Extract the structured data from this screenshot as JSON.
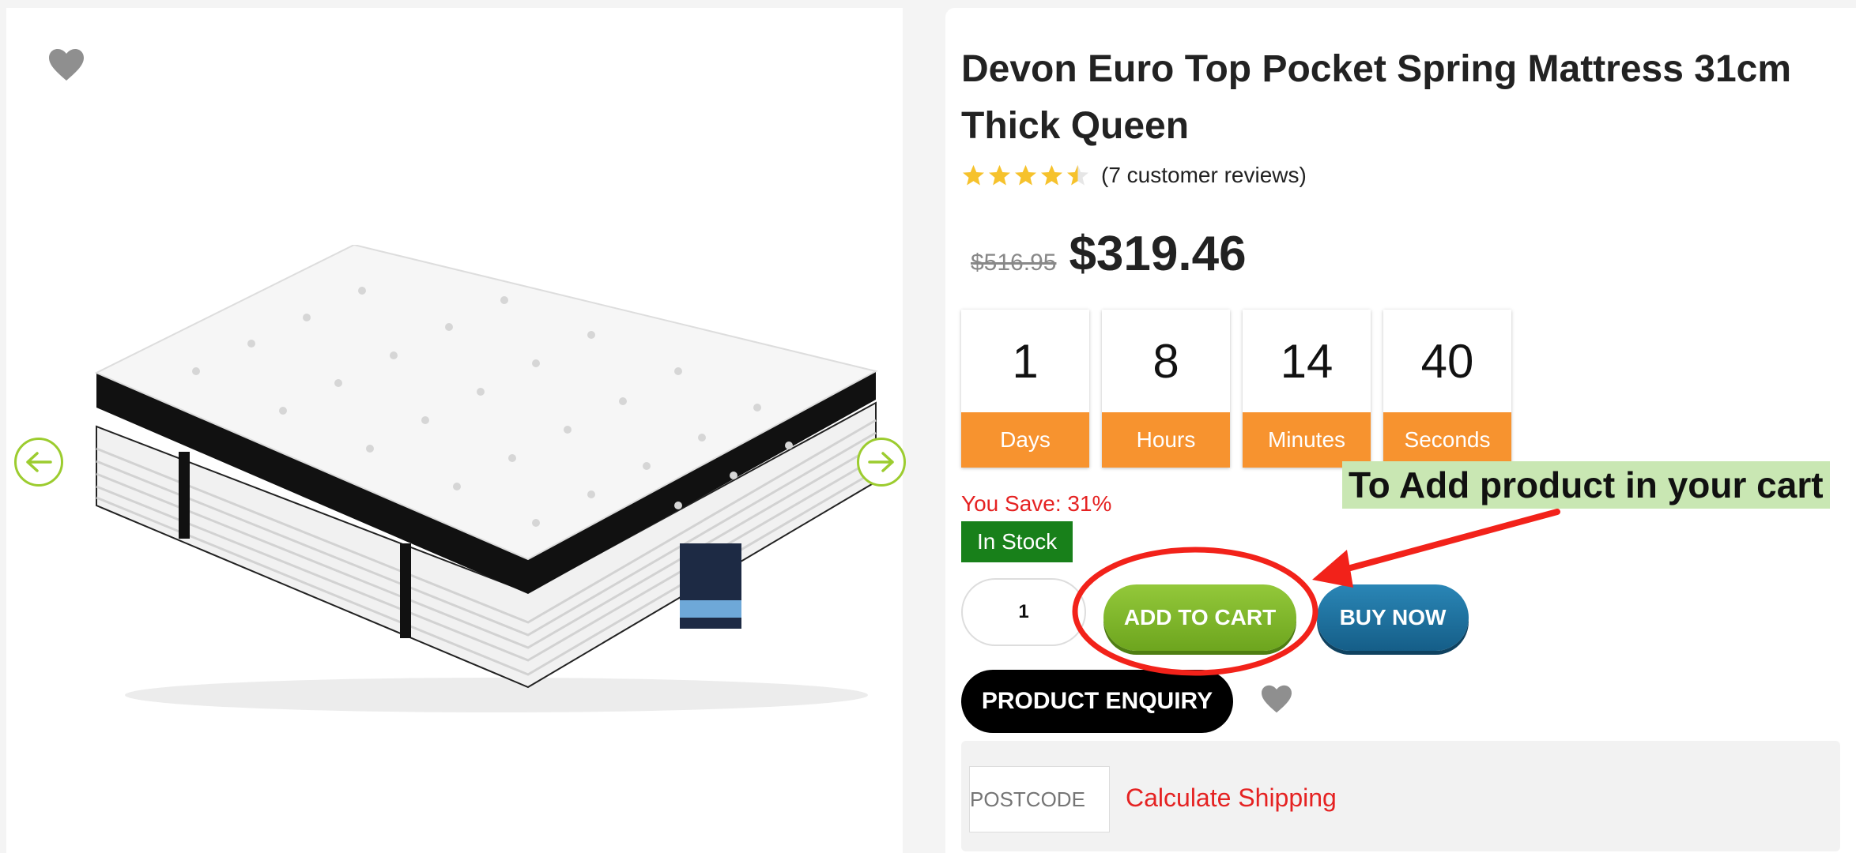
{
  "product": {
    "title": "Devon Euro Top Pocket Spring Mattress 31cm Thick Queen",
    "rating": 4.5,
    "reviews_text": "(7 customer reviews)",
    "old_price": "$516.95",
    "price": "$319.46",
    "you_save": "You Save: 31%",
    "stock_status": "In Stock"
  },
  "countdown": [
    {
      "value": "1",
      "label": "Days"
    },
    {
      "value": "8",
      "label": "Hours"
    },
    {
      "value": "14",
      "label": "Minutes"
    },
    {
      "value": "40",
      "label": "Seconds"
    }
  ],
  "cart": {
    "quantity": "1",
    "add_to_cart_label": "ADD TO CART",
    "buy_now_label": "BUY NOW",
    "enquiry_label": "PRODUCT ENQUIRY"
  },
  "shipping": {
    "postcode_placeholder": "POSTCODE",
    "calculate_label": "Calculate Shipping"
  },
  "annotation": {
    "text": "To Add product in your cart"
  },
  "icons": {
    "wishlist": "heart-icon",
    "prev": "arrow-left-icon",
    "next": "arrow-right-icon",
    "rating": "star-icon"
  },
  "colors": {
    "accent_green": "#8bc034",
    "countdown_orange": "#f7932f",
    "stock_green": "#18801a",
    "buy_blue": "#1e73a0",
    "warning_red": "#e52222",
    "annotation_red": "#f2221a",
    "annotation_bg": "#c9e7b3"
  }
}
